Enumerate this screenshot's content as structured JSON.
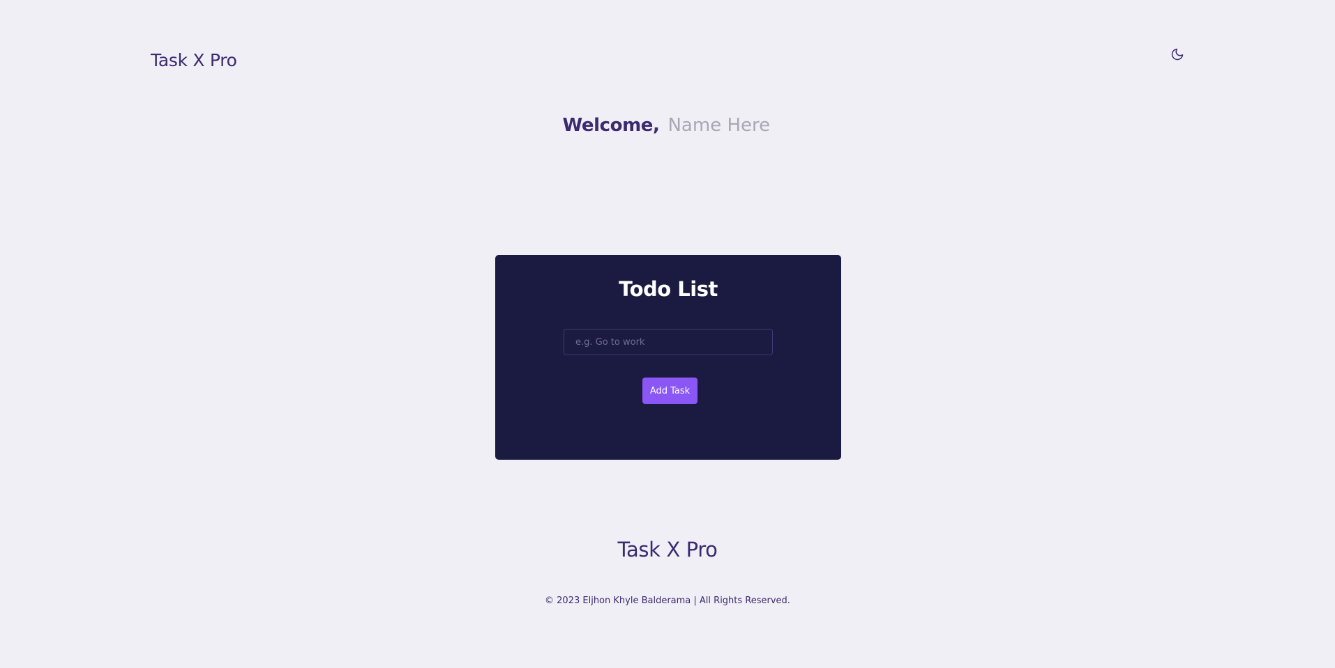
{
  "header": {
    "brand": "Task X Pro",
    "theme_toggle_icon": "moon-icon"
  },
  "welcome": {
    "label": "Welcome,",
    "name_placeholder": "Name Here"
  },
  "todo": {
    "title": "Todo List",
    "input_placeholder": "e.g. Go to work",
    "input_value": "",
    "add_button_label": "Add Task"
  },
  "footer": {
    "brand": "Task X Pro",
    "copyright": "© 2023 Eljhon Khyle Balderama | All Rights Reserved."
  },
  "colors": {
    "background": "#f0eff6",
    "primary_text": "#3b2a6f",
    "card_background": "#1b1a40",
    "accent": "#8a57f6"
  }
}
